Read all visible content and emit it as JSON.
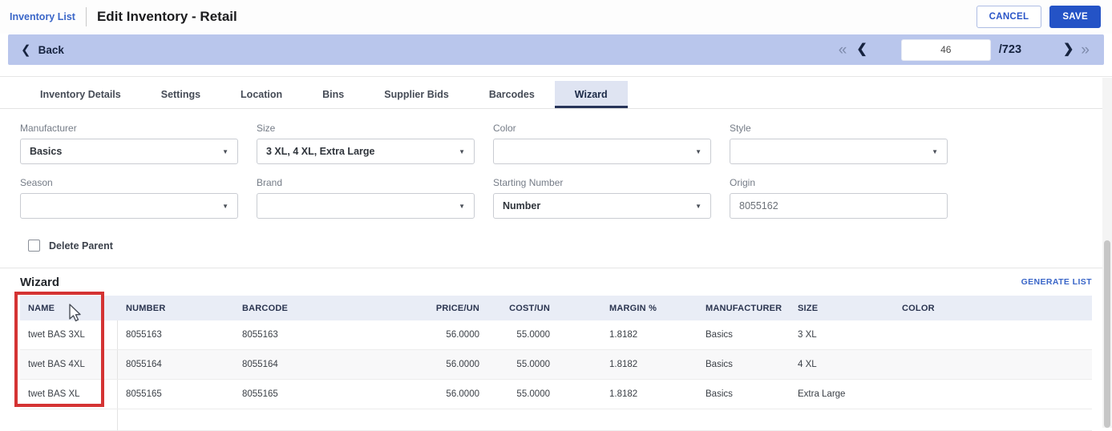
{
  "header": {
    "breadcrumb": "Inventory List",
    "title": "Edit Inventory - Retail",
    "cancel_label": "CANCEL",
    "save_label": "SAVE"
  },
  "nav": {
    "back_label": "Back",
    "page_value": "46",
    "page_total": "/723"
  },
  "icons": {
    "back_chevron": "❮",
    "first_page": "«",
    "prev_page": "❮",
    "next_page": "❯",
    "last_page": "»",
    "dropdown_arrow": "▼"
  },
  "tabs": [
    {
      "label": "Inventory Details",
      "active": false
    },
    {
      "label": "Settings",
      "active": false
    },
    {
      "label": "Location",
      "active": false
    },
    {
      "label": "Bins",
      "active": false
    },
    {
      "label": "Supplier Bids",
      "active": false
    },
    {
      "label": "Barcodes",
      "active": false
    },
    {
      "label": "Wizard",
      "active": true
    }
  ],
  "form": {
    "fields": [
      {
        "label": "Manufacturer",
        "value": "Basics",
        "type": "dropdown"
      },
      {
        "label": "Size",
        "value": "3 XL, 4 XL, Extra Large",
        "type": "dropdown"
      },
      {
        "label": "Color",
        "value": "",
        "type": "dropdown"
      },
      {
        "label": "Style",
        "value": "",
        "type": "dropdown"
      },
      {
        "label": "Season",
        "value": "",
        "type": "dropdown"
      },
      {
        "label": "Brand",
        "value": "",
        "type": "dropdown"
      },
      {
        "label": "Starting Number",
        "value": "Number",
        "type": "dropdown"
      },
      {
        "label": "Origin",
        "value": "8055162",
        "type": "text"
      }
    ],
    "delete_parent_label": "Delete Parent",
    "delete_parent_checked": false
  },
  "wizard": {
    "title": "Wizard",
    "generate_list_label": "GENERATE LIST",
    "table": {
      "columns": [
        "NAME",
        "NUMBER",
        "BARCODE",
        "PRICE/UN",
        "COST/UN",
        "MARGIN %",
        "MANUFACTURER",
        "SIZE",
        "COLOR"
      ],
      "rows": [
        [
          "twet BAS 3XL",
          "8055163",
          "8055163",
          "56.0000",
          "55.0000",
          "1.8182",
          "Basics",
          "3 XL",
          ""
        ],
        [
          "twet BAS 4XL",
          "8055164",
          "8055164",
          "56.0000",
          "55.0000",
          "1.8182",
          "Basics",
          "4 XL",
          ""
        ],
        [
          "twet BAS XL",
          "8055165",
          "8055165",
          "56.0000",
          "55.0000",
          "1.8182",
          "Basics",
          "Extra Large",
          ""
        ]
      ]
    }
  },
  "annotation": {
    "highlight_color": "#d43333",
    "highlighted_column": "NAME"
  },
  "colors": {
    "accent_blue": "#2453c6",
    "link_blue": "#3a66c8",
    "back_bar": "#b9c6ec",
    "tab_active_bg": "#dfe4f2",
    "table_header_bg": "#e9edf6"
  }
}
